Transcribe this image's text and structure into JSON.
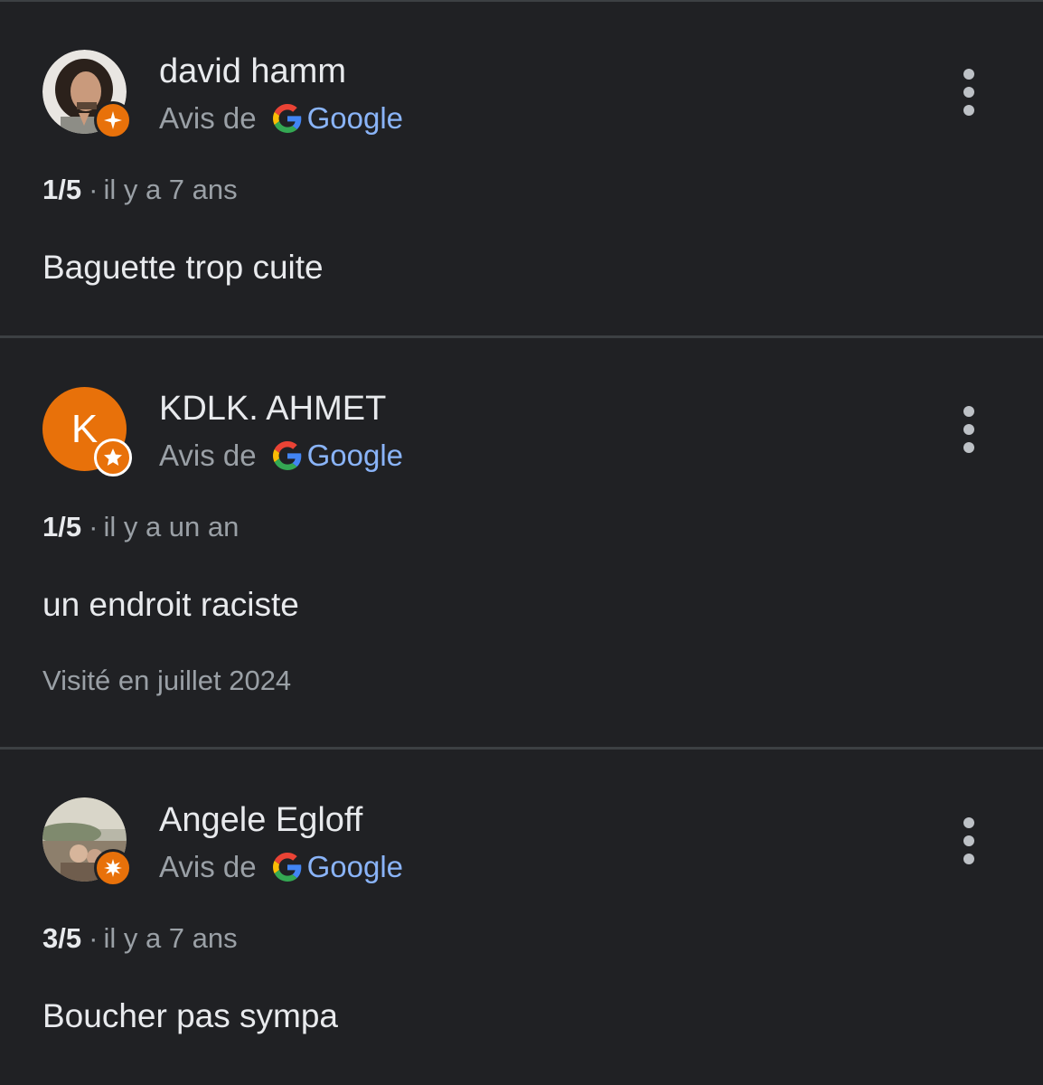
{
  "reviews": [
    {
      "author": "david hamm",
      "avatar_type": "photo",
      "source_prefix": "Avis de",
      "source_name": "Google",
      "rating": "1/5",
      "separator": "·",
      "time": "il y a 7 ans",
      "text": "Baguette trop cuite",
      "visit": ""
    },
    {
      "author": "KDLK. AHMET",
      "avatar_type": "letter",
      "avatar_letter": "K",
      "source_prefix": "Avis de",
      "source_name": "Google",
      "rating": "1/5",
      "separator": "·",
      "time": "il y a un an",
      "text": "un endroit raciste",
      "visit": "Visité en juillet 2024"
    },
    {
      "author": "Angele Egloff",
      "avatar_type": "photo",
      "source_prefix": "Avis de",
      "source_name": "Google",
      "rating": "3/5",
      "separator": "·",
      "time": "il y a 7 ans",
      "text": "Boucher pas sympa",
      "visit": ""
    }
  ],
  "colors": {
    "background": "#202124",
    "divider": "#3c4043",
    "primary_text": "#e8eaed",
    "secondary_text": "#9aa0a6",
    "google_link": "#8ab4f8",
    "local_guide_badge": "#e8710a",
    "avatar_letter_bg": "#e8710a"
  },
  "icons": {
    "local_guide": "local-guide-badge-icon",
    "google": "google-g-icon",
    "more": "more-vertical-icon"
  }
}
